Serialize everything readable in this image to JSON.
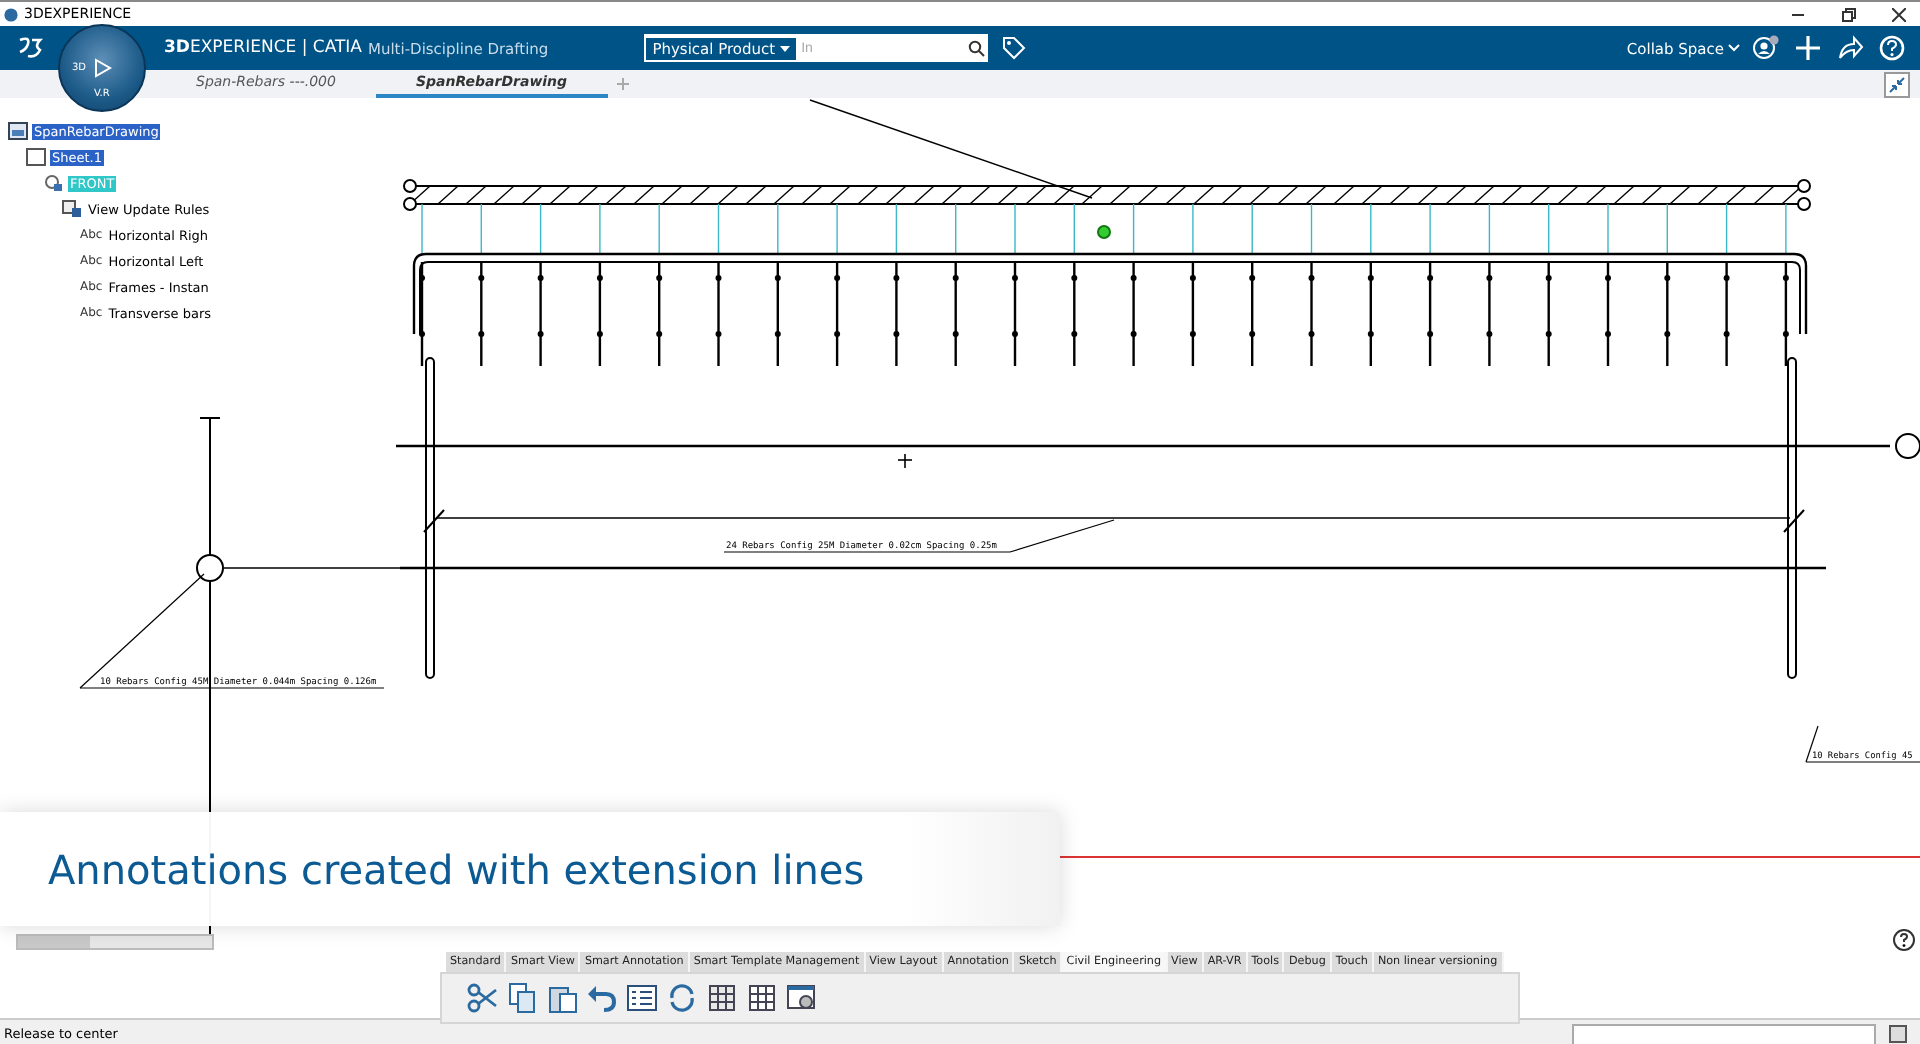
{
  "window": {
    "title": "3DEXPERIENCE"
  },
  "header": {
    "brand_bold": "3D",
    "brand_rest": "EXPERIENCE | CATIA",
    "app_name": "Multi-Discipline Drafting",
    "compass_labels": [
      "3D",
      "V.R"
    ],
    "search_scope": "Physical Product",
    "search_placeholder": "In",
    "collab_space": "Collab Space"
  },
  "doc_tabs": [
    {
      "label": "Span-Rebars ---.000",
      "selected": false
    },
    {
      "label": "SpanRebarDrawing",
      "selected": true
    }
  ],
  "tree": [
    {
      "label": "SpanRebarDrawing",
      "kind": "drawing",
      "selected": true,
      "children": [
        {
          "label": "Sheet.1",
          "kind": "sheet",
          "selected": true,
          "children": [
            {
              "label": "FRONT",
              "kind": "view",
              "selected": true,
              "children": [
                {
                  "label": "View Update Rules",
                  "kind": "rules",
                  "selected": false,
                  "children": [
                    {
                      "label": "Horizontal Righ",
                      "kind": "text",
                      "prefix": "Abc",
                      "selected": false
                    },
                    {
                      "label": "Horizontal Left",
                      "kind": "text",
                      "prefix": "Abc",
                      "selected": false
                    },
                    {
                      "label": "Frames - Instan",
                      "kind": "text",
                      "prefix": "Abc",
                      "selected": false
                    },
                    {
                      "label": "Transverse bars",
                      "kind": "text",
                      "prefix": "Abc",
                      "selected": false
                    }
                  ]
                }
              ]
            }
          ]
        }
      ]
    }
  ],
  "annotations": [
    {
      "text": "24 Rebars Config 25M Diameter 0.02cm Spacing 0.25m",
      "kind": "middle"
    },
    {
      "text": "10 Rebars Config 45M Diameter 0.044m Spacing 0.126m",
      "kind": "left"
    },
    {
      "text": "10 Rebars Config 45",
      "kind": "right"
    }
  ],
  "caption": "Annotations created with extension lines",
  "toolbar_tabs": [
    {
      "label": "Standard",
      "selected": false
    },
    {
      "label": "Smart View",
      "selected": false
    },
    {
      "label": "Smart Annotation",
      "selected": false
    },
    {
      "label": "Smart Template Management",
      "selected": false
    },
    {
      "label": "View Layout",
      "selected": false
    },
    {
      "label": "Annotation",
      "selected": false
    },
    {
      "label": "Sketch",
      "selected": false
    },
    {
      "label": "Civil Engineering",
      "selected": true
    },
    {
      "label": "View",
      "selected": false
    },
    {
      "label": "AR-VR",
      "selected": false
    },
    {
      "label": "Tools",
      "selected": false
    },
    {
      "label": "Debug",
      "selected": false
    },
    {
      "label": "Touch",
      "selected": false
    },
    {
      "label": "Non linear versioning",
      "selected": false
    }
  ],
  "status_bar": {
    "message": "Release to center"
  }
}
